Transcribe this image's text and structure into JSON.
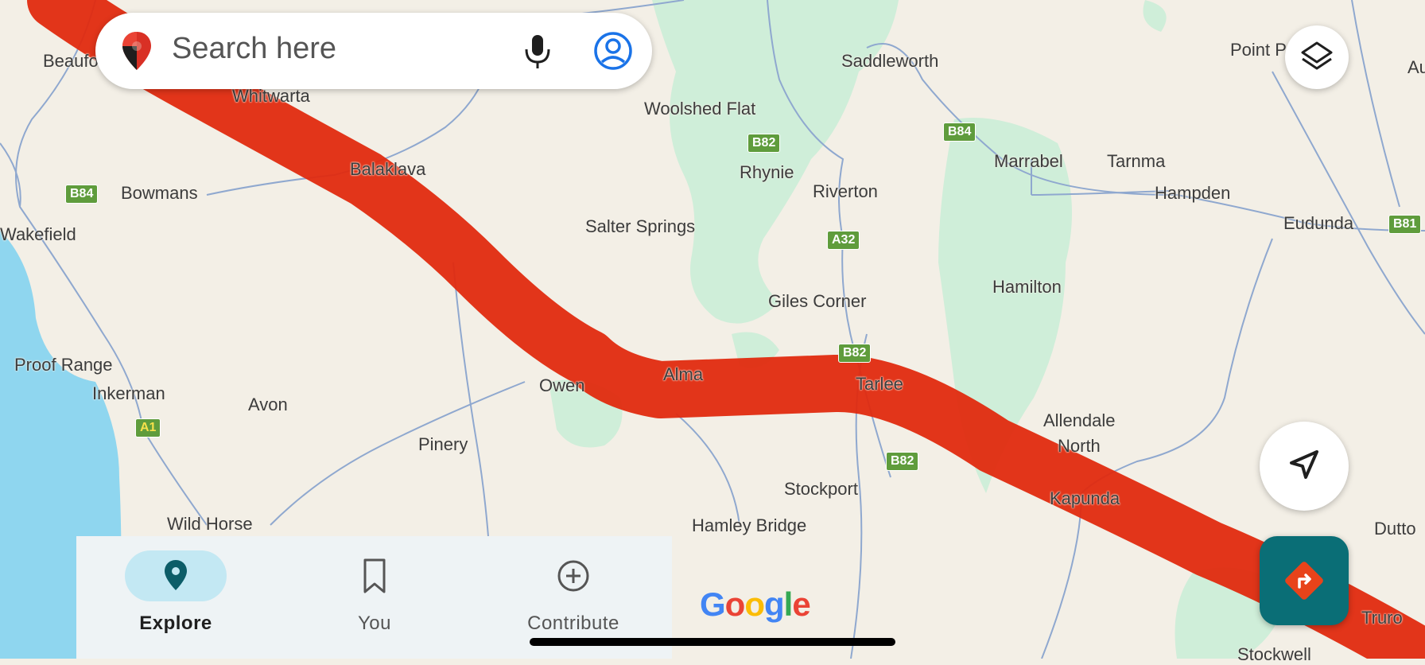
{
  "search": {
    "placeholder": "Search here"
  },
  "places": [
    {
      "name": "Beaufo"
    },
    {
      "name": "Whitwarta"
    },
    {
      "name": "Saddleworth"
    },
    {
      "name": "Point P"
    },
    {
      "name": "Au"
    },
    {
      "name": "Woolshed Flat"
    },
    {
      "name": "Balaklava"
    },
    {
      "name": "Rhynie"
    },
    {
      "name": "Marrabel"
    },
    {
      "name": "Tarnma"
    },
    {
      "name": "Bowmans"
    },
    {
      "name": "Riverton"
    },
    {
      "name": "Hampden"
    },
    {
      "name": "Eudunda"
    },
    {
      "name": "Wakefield"
    },
    {
      "name": "Salter Springs"
    },
    {
      "name": "Giles Corner"
    },
    {
      "name": "Hamilton"
    },
    {
      "name": "Proof Range"
    },
    {
      "name": "Alma"
    },
    {
      "name": "Owen"
    },
    {
      "name": "Tarlee"
    },
    {
      "name": "Inkerman"
    },
    {
      "name": "Avon"
    },
    {
      "name": "Allendale"
    },
    {
      "name": "North"
    },
    {
      "name": "Pinery"
    },
    {
      "name": "Stockport"
    },
    {
      "name": "Kapunda"
    },
    {
      "name": "Dutto"
    },
    {
      "name": "Wild Horse"
    },
    {
      "name": "Hamley Bridge"
    },
    {
      "name": "Truro"
    },
    {
      "name": "Stockwell"
    }
  ],
  "road_shields": [
    {
      "label": "B84"
    },
    {
      "label": "B82"
    },
    {
      "label": "B84"
    },
    {
      "label": "A32"
    },
    {
      "label": "B82"
    },
    {
      "label": "B82"
    },
    {
      "label": "A1"
    },
    {
      "label": "B81"
    }
  ],
  "nav": {
    "items": [
      {
        "label": "Explore",
        "icon": "place-pin-icon",
        "active": true
      },
      {
        "label": "You",
        "icon": "bookmark-icon",
        "active": false
      },
      {
        "label": "Contribute",
        "icon": "add-circle-icon",
        "active": false
      }
    ]
  },
  "google_logo": {
    "letters": [
      "G",
      "o",
      "o",
      "g",
      "l",
      "e"
    ],
    "colors": [
      "#4285F4",
      "#EA4335",
      "#FBBC05",
      "#4285F4",
      "#34A853",
      "#EA4335"
    ]
  },
  "colors": {
    "route_overlay": "#e02a0f",
    "land": "#f3efe6",
    "park": "#cfeed9",
    "water": "#8fd6ef",
    "road": "#8fa8cf",
    "shield": "#5f9c3c",
    "directions_button": "#0a6e76",
    "nav_active_pill": "#c3e8f3"
  }
}
